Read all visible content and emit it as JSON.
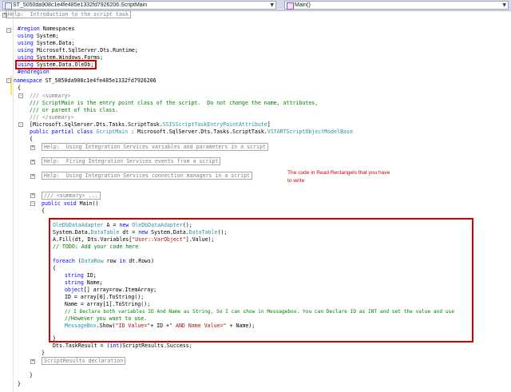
{
  "toolbar": {
    "class_dropdown": "ST_5050da908c1e4fe485e1332fd7926206.ScriptMain",
    "member_dropdown": "Main()"
  },
  "annotation": "The code in Read Rectangels that you have to write",
  "code": {
    "l1": "Help:  Introduction to the script task",
    "l2a": "#region",
    "l2b": " Namespaces",
    "l3a": "using",
    "l3b": " System;",
    "l4a": "using",
    "l4b": " System.Data;",
    "l5a": "using",
    "l5b": " Microsoft.SqlServer.Dts.Runtime;",
    "l6a": "using",
    "l6b": " System.Windows.Forms;",
    "l7a": "using",
    "l7b": " System.Data.OleDb;",
    "l8a": "#endregion",
    "l9a": "namespace",
    "l9b": " ST_5050da908c1e4fe485e1332fd7926206",
    "l10": "{",
    "l11a": "/// ",
    "l11b": "<summary>",
    "l12": "/// ScriptMain is the entry point class of the script.  Do not change the name, attributes,",
    "l13": "/// or parent of this class.",
    "l14a": "/// ",
    "l14b": "</summary>",
    "l15a": "[Microsoft.SqlServer.Dts.Tasks.ScriptTask.",
    "l15b": "SSISScriptTaskEntryPointAttribute",
    "l15c": "]",
    "l16a": "public partial class",
    "l16b": " ",
    "l16c": "ScriptMain",
    "l16d": " : Microsoft.SqlServer.Dts.Tasks.ScriptTask.",
    "l16e": "VSTARTScriptObjectModelBase",
    "l17": "{",
    "l18": "Help:  Using Integration Services variables and parameters in a script",
    "l19": "Help:  Firing Integration Services events from a script",
    "l20": "Help:  Using Integration Services connection managers in a script",
    "l21": "/// <summary> ...",
    "l22a": "public void",
    "l22b": " Main()",
    "l23": "{",
    "l24a": "OleDbDataAdapter",
    "l24b": " A = ",
    "l24c": "new",
    "l24d": " ",
    "l24e": "OleDbDataAdapter",
    "l24f": "();",
    "l25a": "System.Data.",
    "l25b": "DataTable",
    "l25c": " dt = ",
    "l25d": "new",
    "l25e": " System.Data.",
    "l25f": "DataTable",
    "l25g": "();",
    "l26a": "A.Fill(dt, Dts.Variables[",
    "l26b": "\"User::VarObject\"",
    "l26c": "].Value);",
    "l27": "// TODO: Add your code here",
    "l28a": "foreach",
    "l28b": " (",
    "l28c": "DataRow",
    "l28d": " row ",
    "l28e": "in",
    "l28f": " dt.Rows)",
    "l29": "{",
    "l30a": "string",
    "l30b": " ID;",
    "l31a": "string",
    "l31b": " Name;",
    "l32a": "object",
    "l32b": "[] array=row.ItemArray;",
    "l33": "ID = array[0].ToString();",
    "l34": "Name = array[1].ToString();",
    "l35": "// I Declare both variables ID And Name as String, So I can show in Messagebox. You can Declare ID as INT and set the value and use",
    "l36": "//However you want to use.",
    "l37a": "MessageBox",
    "l37b": ".Show(",
    "l37c": "\"ID Value=\"",
    "l37d": "+ ID +",
    "l37e": "\" AND Name Value=\"",
    "l37f": " + Name);",
    "l38": "}",
    "l39a": "Dts.TaskResult = (",
    "l39b": "int",
    "l39c": ")ScriptResults.Success;",
    "l40": "}",
    "l41": "ScriptResults declaration",
    "l42": "}",
    "l43": "}"
  }
}
